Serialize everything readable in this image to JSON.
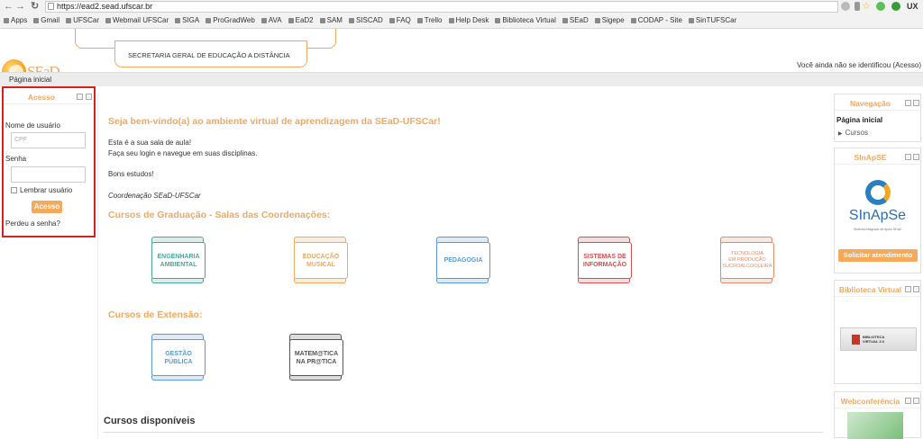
{
  "browser": {
    "url": "https://ead2.sead.ufscar.br",
    "bookmarks": [
      "Apps",
      "Gmail",
      "UFSCar",
      "Webmail UFSCar",
      "SIGA",
      "ProGradWeb",
      "AVA",
      "EaD2",
      "SAM",
      "SISCAD",
      "FAQ",
      "Trello",
      "Help Desk",
      "Biblioteca Virtual",
      "SEaD",
      "Sigepe",
      "CODAP - Site",
      "SinTUFSCar"
    ]
  },
  "header": {
    "logo_text": "SEaD",
    "subtitle": "SECRETARIA GERAL DE EDUCAÇÃO A DISTÂNCIA",
    "login_text": "Você ainda não se identificou (",
    "login_link": "Acesso",
    ")": ")"
  },
  "navbar": {
    "home": "Página inicial"
  },
  "login_block": {
    "title": "Acesso",
    "username_label": "Nome de usuário",
    "username_placeholder": "CPF",
    "password_label": "Senha",
    "remember_label": "Lembrar usuário",
    "submit": "Acesso",
    "forgot": "Perdeu a senha?"
  },
  "main": {
    "welcome": "Seja bem-vindo(a) ao ambiente virtual de aprendizagem da SEaD-UFSCar!",
    "line1": "Esta é a sua sala de aula!",
    "line2": "Faça seu login e navegue em suas disciplinas.",
    "line3": "Bons estudos!",
    "signature": "Coordenação SEaD-UFSCar",
    "grad_heading": "Cursos de Graduação - Salas das Coordenações:",
    "grad": [
      {
        "label": "ENGENHARIA\nAMBIENTAL",
        "color": "#4aa89a"
      },
      {
        "label": "EDUCAÇÃO\nMUSICAL",
        "color": "#f0a860"
      },
      {
        "label": "PEDAGOGIA",
        "color": "#5b9bd5"
      },
      {
        "label": "SISTEMAS DE\nINFORMAÇÃO",
        "color": "#d05050"
      },
      {
        "label": "TECNOLOGIA\nEM PRODUÇÃO\nSUCROALCOOLEIRA",
        "color": "#e08a6a"
      }
    ],
    "ext_heading": "Cursos de Extensão:",
    "ext": [
      {
        "label": "GESTÃO\nPÚBLICA",
        "color": "#5b9bd5"
      },
      {
        "label": "MATEM@TICA\nNA PR@TICA",
        "color": "#555555"
      }
    ],
    "courses_heading": "Cursos disponíveis"
  },
  "nav_block": {
    "title": "Navegação",
    "home": "Página inicial",
    "courses": "Cursos"
  },
  "sinapse": {
    "title": "SInApSE",
    "logo_text": "SInApSe",
    "logo_sub": "Sistema Integrado de Apoio SEaD",
    "button": "Solicitar atendimento"
  },
  "biblioteca": {
    "title": "Biblioteca Virtual",
    "logo_text": "BIBLIOTECA\nVIRTUAL 3.0"
  },
  "webconf": {
    "title": "Webconferência"
  }
}
